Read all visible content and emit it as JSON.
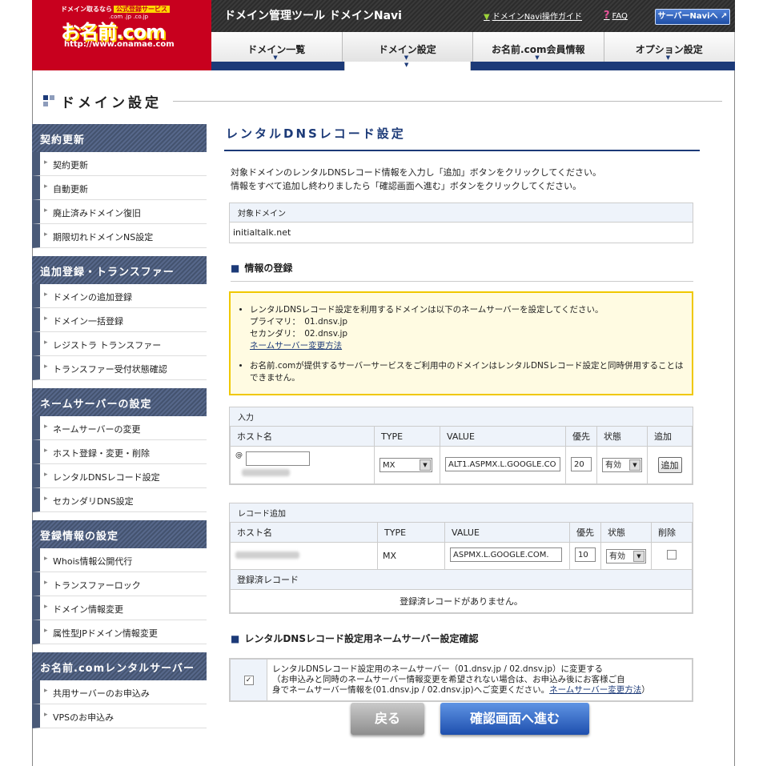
{
  "header": {
    "logo": {
      "tagline": "ドメイン取るなら",
      "badge": "公式登録サービス",
      "tlds": ".com .jp .co.jp",
      "brand": "お名前.com",
      "url": "http://www.onamae.com"
    },
    "tool_title": "ドメイン管理ツール ドメインNavi",
    "guide_link": "ドメインNavi操作ガイド",
    "faq_link": "FAQ",
    "server_navi_button": "サーバーNaviへ ↗"
  },
  "global_nav": [
    {
      "label": "ドメイン一覧"
    },
    {
      "label": "ドメイン設定"
    },
    {
      "label": "お名前.com会員情報"
    },
    {
      "label": "オプション設定"
    }
  ],
  "page_title": "ドメイン設定",
  "sidebar": [
    {
      "title": "契約更新",
      "items": [
        "契約更新",
        "自動更新",
        "廃止済みドメイン復旧",
        "期限切れドメインNS設定"
      ]
    },
    {
      "title": "追加登録・トランスファー",
      "items": [
        "ドメインの追加登録",
        "ドメイン一括登録",
        "レジストラ トランスファー",
        "トランスファー受付状態確認"
      ]
    },
    {
      "title": "ネームサーバーの設定",
      "items": [
        "ネームサーバーの変更",
        "ホスト登録・変更・削除",
        "レンタルDNSレコード設定",
        "セカンダリDNS設定"
      ]
    },
    {
      "title": "登録情報の設定",
      "items": [
        "Whois情報公開代行",
        "トランスファーロック",
        "ドメイン情報変更",
        "属性型JPドメイン情報変更"
      ]
    },
    {
      "title": "お名前.comレンタルサーバー",
      "items": [
        "共用サーバーのお申込み",
        "VPSのお申込み"
      ]
    }
  ],
  "main": {
    "section_title": "レンタルDNSレコード設定",
    "intro_line1": "対象ドメインのレンタルDNSレコード情報を入力し「追加」ボタンをクリックしてください。",
    "intro_line2": "情報をすべて追加し終わりましたら「確認画面へ進む」ボタンをクリックしてください。",
    "target_label": "対象ドメイン",
    "target_domain": "initialtalk.net",
    "info_heading": "情報の登録",
    "notice": {
      "item1": "レンタルDNSレコード設定を利用するドメインは以下のネームサーバーを設定してください。",
      "primary": "プライマリ：　01.dnsv.jp",
      "secondary": "セカンダリ：　02.dnsv.jp",
      "link": "ネームサーバー変更方法",
      "item2": "お名前.comが提供するサーバーサービスをご利用中のドメインはレンタルDNSレコード設定と同時併用することはできません。"
    },
    "input": {
      "caption": "入力",
      "headers": {
        "host": "ホスト名",
        "type": "TYPE",
        "value": "VALUE",
        "priority": "優先",
        "status": "状態",
        "add": "追加"
      },
      "host_prefix": "@",
      "host_value": "",
      "type": "MX",
      "value": "ALT1.ASPMX.L.GOOGLE.CO",
      "priority": "20",
      "status": "有効",
      "add_button": "追加"
    },
    "records": {
      "caption": "レコード追加",
      "headers": {
        "host": "ホスト名",
        "type": "TYPE",
        "value": "VALUE",
        "priority": "優先",
        "status": "状態",
        "delete": "削除"
      },
      "rows": [
        {
          "type": "MX",
          "value": "ASPMX.L.GOOGLE.COM.",
          "priority": "10",
          "status": "有効"
        }
      ],
      "registered_caption": "登録済レコード",
      "registered_empty": "登録済レコードがありません。"
    },
    "confirm_heading": "レンタルDNSレコード設定用ネームサーバー設定確認",
    "confirm": {
      "line1": "レンタルDNSレコード設定用のネームサーバー（01.dnsv.jp / 02.dnsv.jp）に変更する",
      "line2": "（お申込みと同時のネームサーバー情報変更を希望されない場合は、お申込み後にお客様ご自",
      "line3": "身でネームサーバー情報を(01.dnsv.jp / 02.dnsv.jp)へご変更ください。",
      "link": "ネームサーバー変更方法",
      "close": "）",
      "checked": true
    }
  },
  "buttons": {
    "back": "戻る",
    "next": "確認画面へ進む"
  }
}
